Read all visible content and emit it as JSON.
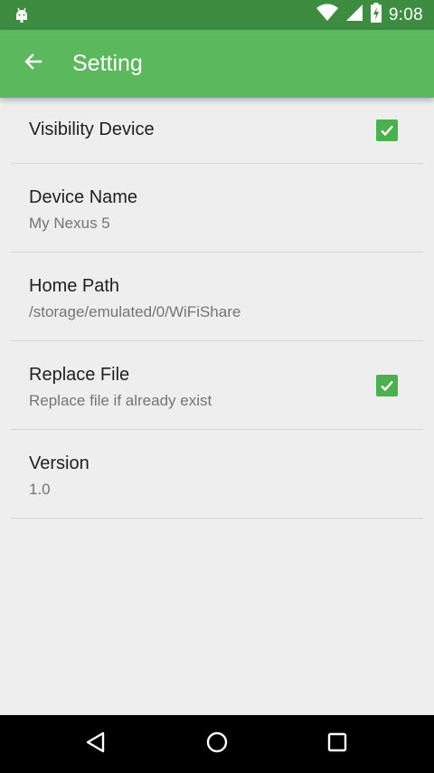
{
  "status_bar": {
    "time": "9:08",
    "icons": [
      "android-debug-icon",
      "wifi-icon",
      "signal-icon",
      "battery-charging-icon"
    ]
  },
  "app_bar": {
    "title": "Setting",
    "back_icon": "arrow-back-icon"
  },
  "settings": [
    {
      "label": "Visibility Device",
      "checked": true
    },
    {
      "label": "Device Name",
      "summary": "My Nexus 5"
    },
    {
      "label": "Home Path",
      "summary": "/storage/emulated/0/WiFiShare"
    },
    {
      "label": "Replace File",
      "summary": "Replace file if already exist",
      "checked": true
    },
    {
      "label": "Version",
      "summary": "1.0"
    }
  ],
  "nav_bar": {
    "icons": [
      "nav-back-icon",
      "nav-home-icon",
      "nav-recents-icon"
    ]
  },
  "colors": {
    "status_bar": "#3d8c40",
    "app_bar": "#5cb85c",
    "checkbox": "#4caf50",
    "background": "#eeeeee"
  }
}
